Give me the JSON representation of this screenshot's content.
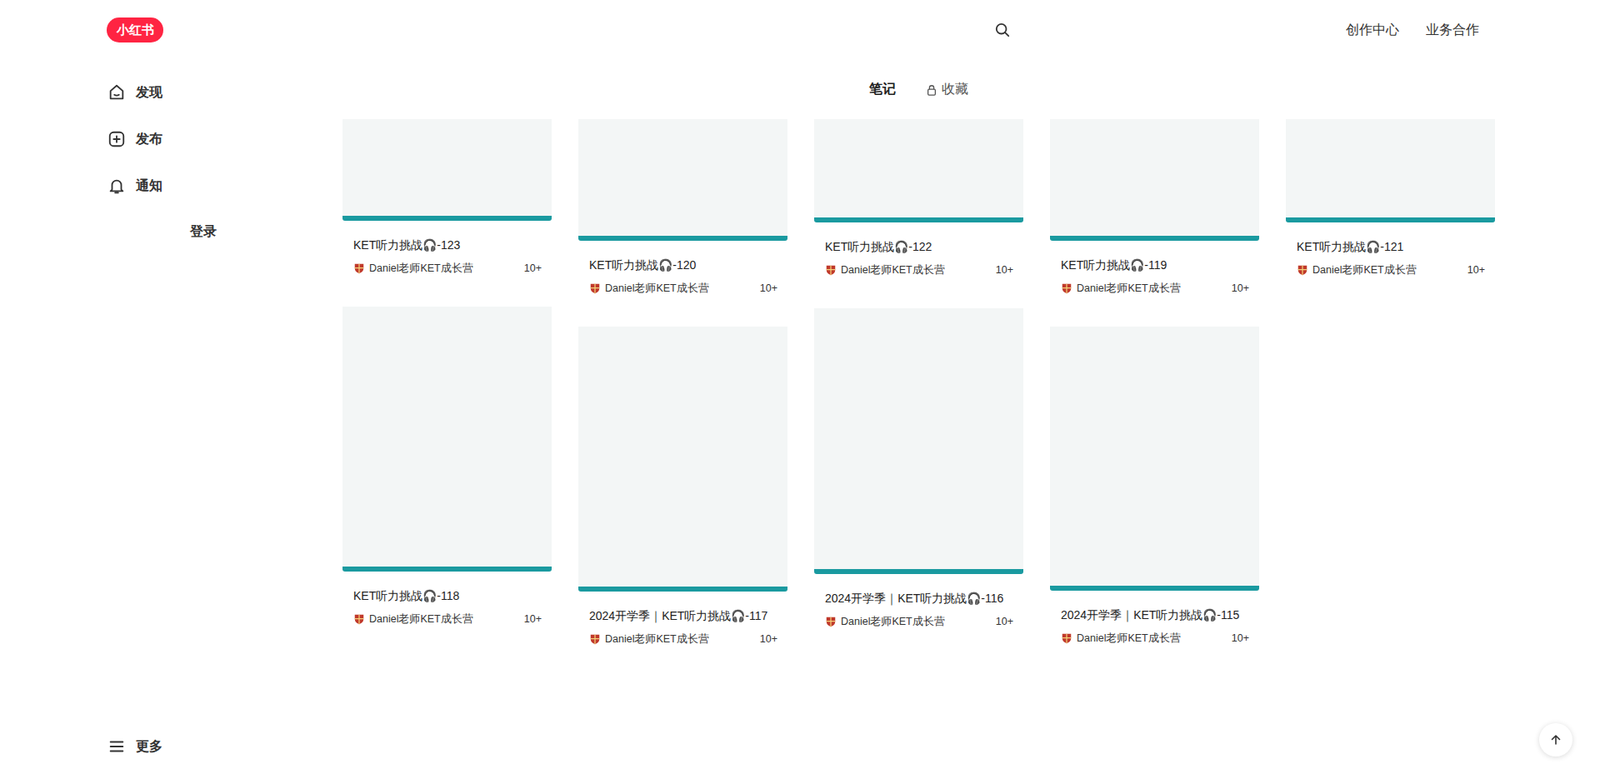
{
  "logo": "小红书",
  "header_links": [
    "创作中心",
    "业务合作"
  ],
  "sidebar": {
    "items": [
      {
        "label": "发现"
      },
      {
        "label": "发布"
      },
      {
        "label": "通知"
      }
    ],
    "login": "登录",
    "more": "更多"
  },
  "tabs": [
    {
      "label": "笔记",
      "selected": true,
      "locked": false
    },
    {
      "label": "收藏",
      "selected": false,
      "locked": true
    }
  ],
  "notes": [
    {
      "title": "KET听力挑战🎧-123",
      "author": "Daniel老师KET成长营",
      "likes": "10+"
    },
    {
      "title": "KET听力挑战🎧-120",
      "author": "Daniel老师KET成长营",
      "likes": "10+"
    },
    {
      "title": "KET听力挑战🎧-122",
      "author": "Daniel老师KET成长营",
      "likes": "10+"
    },
    {
      "title": "KET听力挑战🎧-119",
      "author": "Daniel老师KET成长营",
      "likes": "10+"
    },
    {
      "title": "KET听力挑战🎧-121",
      "author": "Daniel老师KET成长营",
      "likes": "10+"
    },
    {
      "title": "KET听力挑战🎧-118",
      "author": "Daniel老师KET成长营",
      "likes": "10+"
    },
    {
      "title": "2024开学季｜KET听力挑战🎧-117",
      "author": "Daniel老师KET成长营",
      "likes": "10+"
    },
    {
      "title": "2024开学季｜KET听力挑战🎧-116",
      "author": "Daniel老师KET成长营",
      "likes": "10+"
    },
    {
      "title": "2024开学季｜KET听力挑战🎧-115",
      "author": "Daniel老师KET成长营",
      "likes": "10+"
    }
  ]
}
